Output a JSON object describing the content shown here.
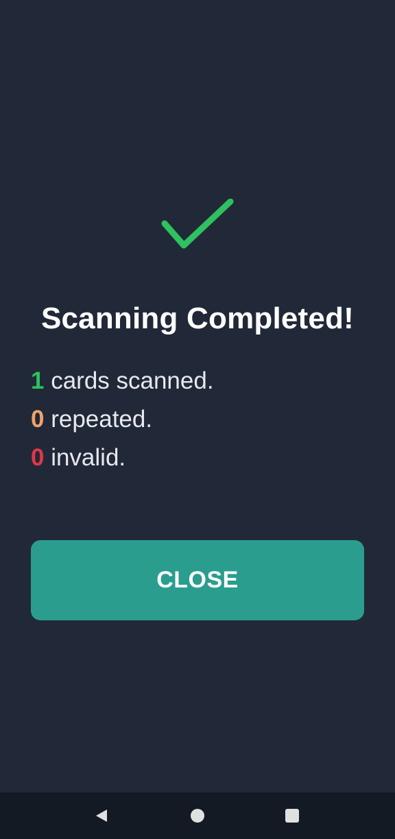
{
  "dialog": {
    "title": "Scanning Completed!",
    "stats": [
      {
        "count": "1",
        "label": " cards scanned.",
        "color": "#2fc15f"
      },
      {
        "count": "0",
        "label": " repeated.",
        "color": "#f0a26b"
      },
      {
        "count": "0",
        "label": " invalid.",
        "color": "#e3354a"
      }
    ],
    "close_label": "CLOSE"
  },
  "nav": {
    "back": "back-icon",
    "home": "home-icon",
    "recents": "recents-icon"
  },
  "colors": {
    "background": "#212938",
    "check": "#2fc15f",
    "button": "#2a9d8f",
    "navbar": "#141a24"
  }
}
